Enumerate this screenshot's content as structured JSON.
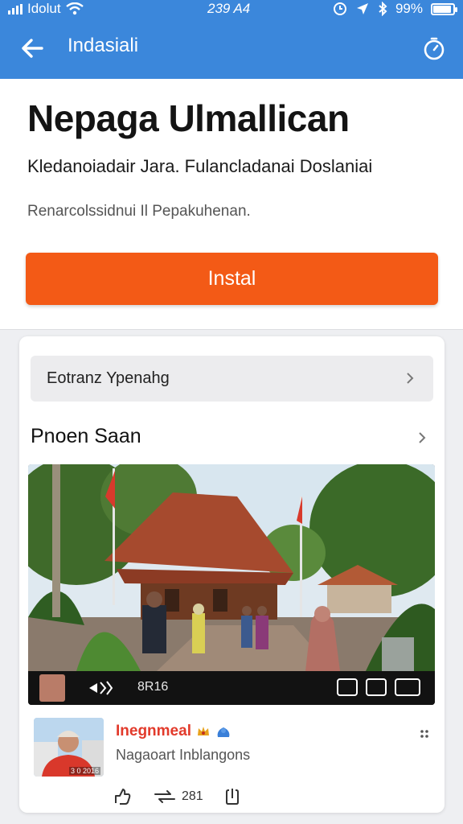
{
  "status_bar": {
    "carrier": "Idolut",
    "time": "239 A4",
    "battery": "99%"
  },
  "app_bar": {
    "title": "Indasiali"
  },
  "header": {
    "app_title": "Nepaga Ulmallican",
    "subtitle": "Kledanoiadair Jara. Fulancladanai Doslaniai",
    "meta": "Renarcolssidnui  Il Pepakuhenan.",
    "install_label": "Instal"
  },
  "card": {
    "search_row_label": "Eotranz Ypenahg",
    "section_title": "Pnoen Saan",
    "video_bar": {
      "count": "8R16"
    },
    "post": {
      "avatar_caption": "3 0 2016",
      "author": "Inegnmeal",
      "description": "Nagaoart Inblangons"
    },
    "actions": {
      "repost_count": "281"
    }
  },
  "colors": {
    "app_bar": "#3b87db",
    "install_button": "#f35a16",
    "author_name": "#e23a2b"
  }
}
